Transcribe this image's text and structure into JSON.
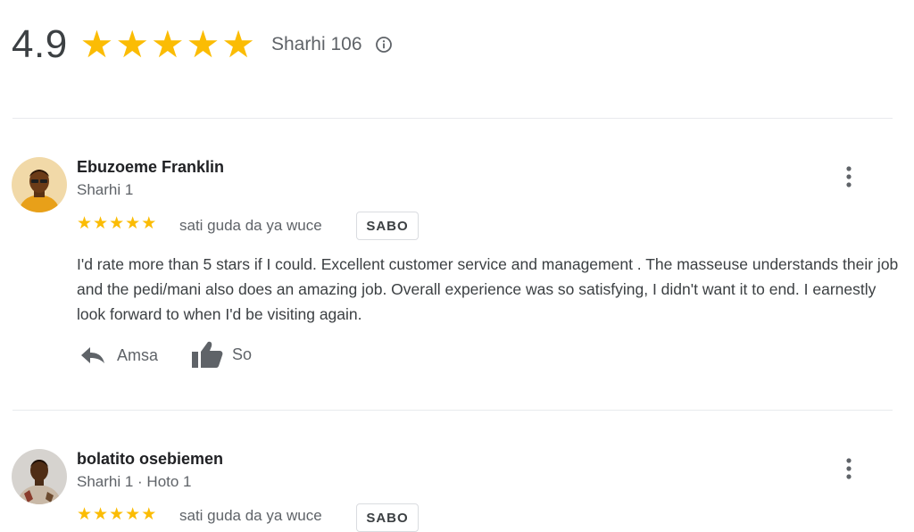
{
  "summary": {
    "rating": "4.9",
    "stars": 5,
    "count_label": "Sharhi 106",
    "info_icon": "info-icon"
  },
  "reviews": [
    {
      "author": "Ebuzoeme Franklin",
      "meta": "Sharhi 1",
      "stars": 5,
      "time": "sati guda da ya wuce",
      "badge": "SABO",
      "text": "I'd rate more than 5 stars if I could. Excellent customer service and management . The masseuse understands their job and the pedi/mani also does an amazing job. Overall experience was so satisfying, I didn't want it to end. I earnestly look forward to when I'd be visiting again.",
      "reply_label": "Amsa",
      "like_label": "So"
    },
    {
      "author": "bolatito osebiemen",
      "meta": "Sharhi 1 · Hoto 1",
      "stars": 5,
      "time": "sati guda da ya wuce",
      "badge": "SABO"
    }
  ],
  "colors": {
    "star": "#fbbc04",
    "muted": "#5f6368",
    "divider": "#e8eaed"
  }
}
